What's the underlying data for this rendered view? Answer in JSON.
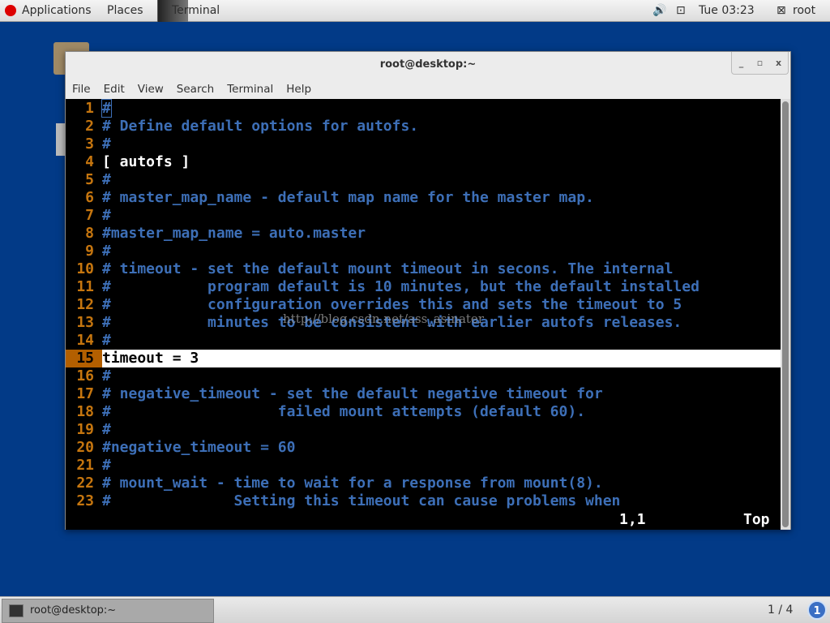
{
  "topbar": {
    "applications": "Applications",
    "places": "Places",
    "terminal": "Terminal",
    "volume_icon": "🔊",
    "network_icon": "⊡",
    "clock": "Tue 03:23",
    "user_icon": "⊠",
    "user": "root"
  },
  "window": {
    "title": "root@desktop:~",
    "minimize": "_",
    "maximize": "▫",
    "close": "x"
  },
  "menu": [
    "File",
    "Edit",
    "View",
    "Search",
    "Terminal",
    "Help"
  ],
  "editor": {
    "lines": [
      {
        "num": "1",
        "text": "#",
        "style": "comment"
      },
      {
        "num": "2",
        "text": "# Define default options for autofs.",
        "style": "comment"
      },
      {
        "num": "3",
        "text": "#",
        "style": "comment"
      },
      {
        "num": "4",
        "text": "[ autofs ]",
        "style": "plain"
      },
      {
        "num": "5",
        "text": "#",
        "style": "comment"
      },
      {
        "num": "6",
        "text": "# master_map_name - default map name for the master map.",
        "style": "comment"
      },
      {
        "num": "7",
        "text": "#",
        "style": "comment"
      },
      {
        "num": "8",
        "text": "#master_map_name = auto.master",
        "style": "comment"
      },
      {
        "num": "9",
        "text": "#",
        "style": "comment"
      },
      {
        "num": "10",
        "text": "# timeout - set the default mount timeout in secons. The internal",
        "style": "comment"
      },
      {
        "num": "11",
        "text": "#           program default is 10 minutes, but the default installed",
        "style": "comment"
      },
      {
        "num": "12",
        "text": "#           configuration overrides this and sets the timeout to 5",
        "style": "comment"
      },
      {
        "num": "13",
        "text": "#           minutes to be consistent with earlier autofs releases.",
        "style": "comment"
      },
      {
        "num": "14",
        "text": "#",
        "style": "comment"
      },
      {
        "num": "15",
        "text": "timeout = 3",
        "style": "cursorline"
      },
      {
        "num": "16",
        "text": "#",
        "style": "comment"
      },
      {
        "num": "17",
        "text": "# negative_timeout - set the default negative timeout for",
        "style": "comment"
      },
      {
        "num": "18",
        "text": "#                   failed mount attempts (default 60).",
        "style": "comment"
      },
      {
        "num": "19",
        "text": "#",
        "style": "comment"
      },
      {
        "num": "20",
        "text": "#negative_timeout = 60",
        "style": "comment"
      },
      {
        "num": "21",
        "text": "#",
        "style": "comment"
      },
      {
        "num": "22",
        "text": "# mount_wait - time to wait for a response from mount(8).",
        "style": "comment"
      },
      {
        "num": "23",
        "text": "#              Setting this timeout can cause problems when",
        "style": "comment"
      }
    ],
    "position": "1,1",
    "scroll": "Top",
    "watermark": "http://blog.csdn.net/ass_asinater"
  },
  "colors": {
    "desktop": "#023a87",
    "comment": "#3d6fb7",
    "line_number": "#c6760f"
  },
  "taskbar": {
    "task": "root@desktop:~",
    "workspace": "1 / 4",
    "workspace_badge": "1"
  }
}
